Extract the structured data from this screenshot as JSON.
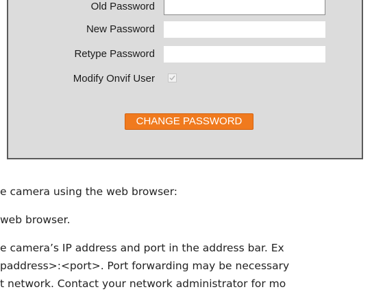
{
  "form": {
    "old_password_label": "Old Password",
    "new_password_label": "New Password",
    "retype_password_label": "Retype Password",
    "modify_onvif_label": "Modify Onvif User",
    "modify_onvif_checked": true,
    "change_button_label": "CHANGE PASSWORD"
  },
  "doc": {
    "line1": "e camera using the web browser:",
    "line2": "web browser.",
    "line3": "e camera’s IP address and port in the address bar. Ex",
    "line4": "paddress>:<port>. Port forwarding may be necessary",
    "line5": "t network. Contact your network administrator for mo"
  },
  "colors": {
    "panel_bg": "#dcdcdc",
    "button_bg": "#f07a1e",
    "button_text": "#ffffff"
  }
}
